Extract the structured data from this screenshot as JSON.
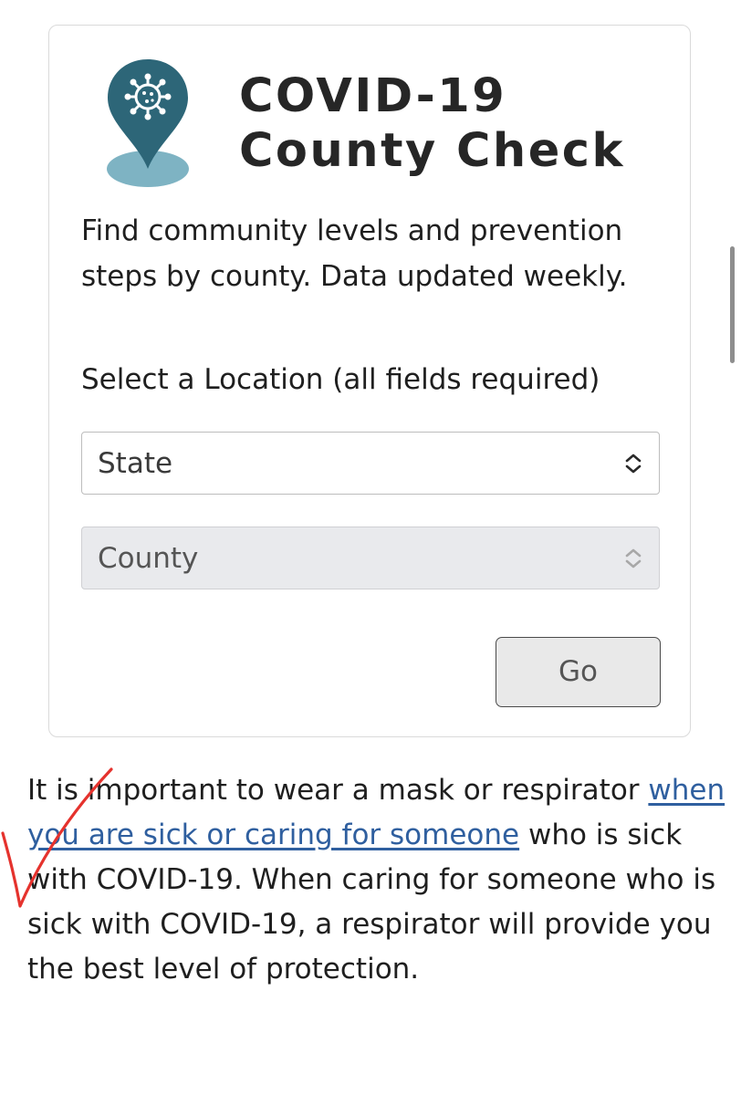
{
  "card": {
    "title_line1": "COVID-19",
    "title_line2": "County Check",
    "description": "Find community levels and prevention steps by county. Data updated weekly.",
    "location_label": "Select a Location (all fields required)",
    "state_select": {
      "value": "State"
    },
    "county_select": {
      "value": "County",
      "disabled": true
    },
    "go_button": "Go",
    "logo_icon": "virus-map-pin-icon"
  },
  "article": {
    "text_before": "It is important to wear a mask or respirator ",
    "link_text": "when you are sick or caring for someone",
    "text_after": " who is sick with COVID-19. When caring for someone who is sick with COVID-19, a respirator will provide you the best level of protection."
  },
  "colors": {
    "logo_dark": "#2d6678",
    "logo_light": "#7eb3c3",
    "link": "#2f5f9f",
    "annotation": "#e5322d"
  }
}
